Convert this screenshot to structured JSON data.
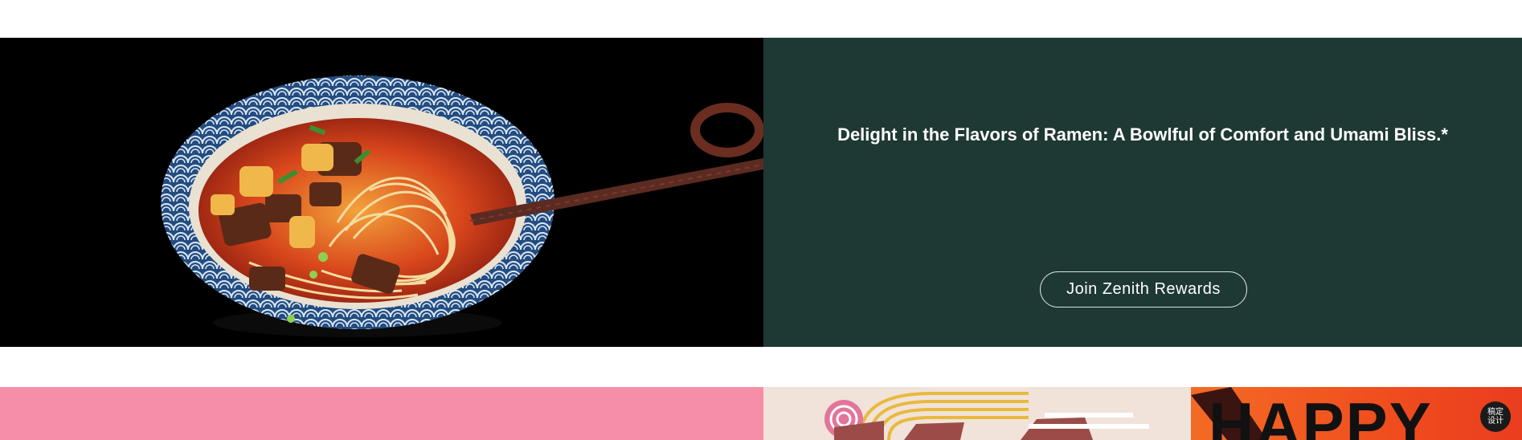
{
  "hero": {
    "heading": "Delight in the Flavors of Ramen: A Bowlful of Comfort and Umami Bliss.*",
    "cta_label": "Join Zenith Rewards",
    "panel_color": "#1e3833",
    "image": {
      "subject": "ramen-bowl-with-chopsticks",
      "background": "#000000"
    }
  },
  "promo": {
    "pink_color": "#f78ea8",
    "noodle_background": "#f1e3da",
    "happy_text": "HAPPY",
    "badge_text": "稿定\n设计"
  }
}
